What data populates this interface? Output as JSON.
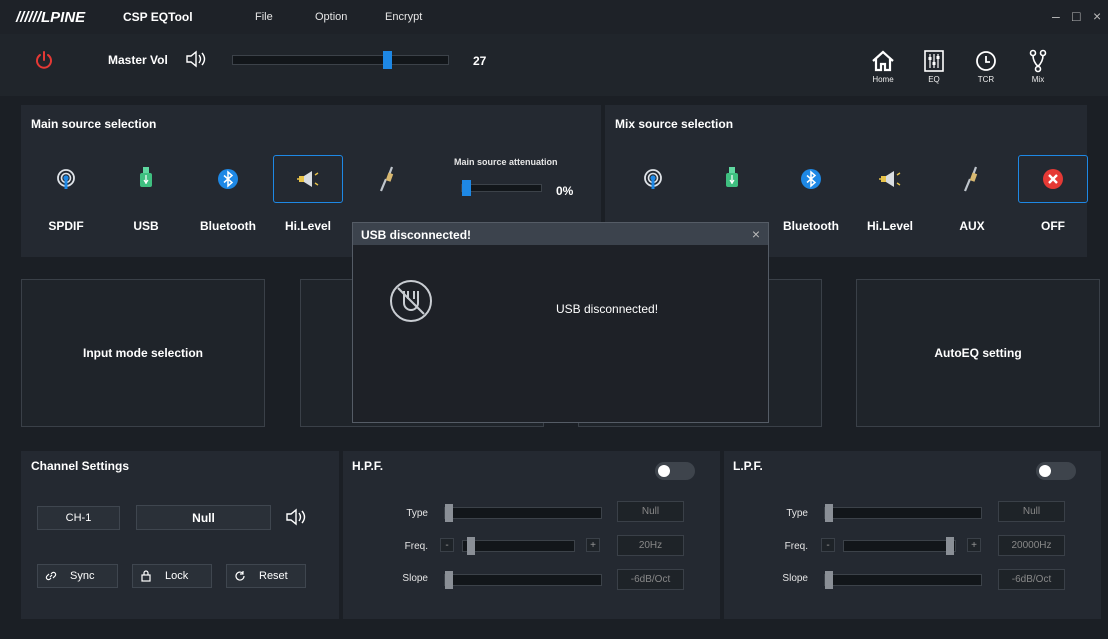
{
  "window": {
    "logo": "//////LPINE",
    "title": "CSP EQTool",
    "minimize": "–",
    "maximize": "□",
    "close": "×"
  },
  "menu": [
    "File",
    "Option",
    "Encrypt"
  ],
  "master": {
    "label": "Master Vol",
    "value": "27",
    "level": 0.73
  },
  "nav": [
    {
      "label": "Home",
      "icon": "home-icon"
    },
    {
      "label": "EQ",
      "icon": "eq-icon"
    },
    {
      "label": "TCR",
      "icon": "clock-icon"
    },
    {
      "label": "Mix",
      "icon": "mix-icon"
    }
  ],
  "main_source": {
    "title": "Main source selection",
    "items": [
      "SPDIF",
      "USB",
      "Bluetooth",
      "Hi.Level"
    ],
    "selected": "Hi.Level",
    "attenuation_label": "Main source attenuation",
    "attenuation_value": "0%",
    "attenuation_level": 0.0
  },
  "mix_source": {
    "title": "Mix source selection",
    "items": [
      "Bluetooth",
      "Hi.Level",
      "AUX",
      "OFF"
    ],
    "selected": "OFF"
  },
  "tiles": {
    "input_mode": "Input mode selection",
    "autoeq": "AutoEQ setting"
  },
  "channel": {
    "title": "Channel Settings",
    "channel": "CH-1",
    "mode": "Null",
    "sync": "Sync",
    "lock": "Lock",
    "reset": "Reset"
  },
  "hpf": {
    "title": "H.P.F.",
    "type_label": "Type",
    "freq_label": "Freq.",
    "slope_label": "Slope",
    "type_value": "Null",
    "freq_value": "20Hz",
    "slope_value": "-6dB/Oct",
    "minus": "-",
    "plus": "+",
    "enabled": false
  },
  "lpf": {
    "title": "L.P.F.",
    "type_label": "Type",
    "freq_label": "Freq.",
    "slope_label": "Slope",
    "type_value": "Null",
    "freq_value": "20000Hz",
    "slope_value": "-6dB/Oct",
    "minus": "-",
    "plus": "+",
    "enabled": false
  },
  "dialog": {
    "title": "USB disconnected!",
    "message": "USB disconnected!",
    "close": "×"
  },
  "colors": {
    "accent": "#1e88e5",
    "power": "#e53935",
    "panel": "#242931",
    "background": "#1b1f25"
  }
}
